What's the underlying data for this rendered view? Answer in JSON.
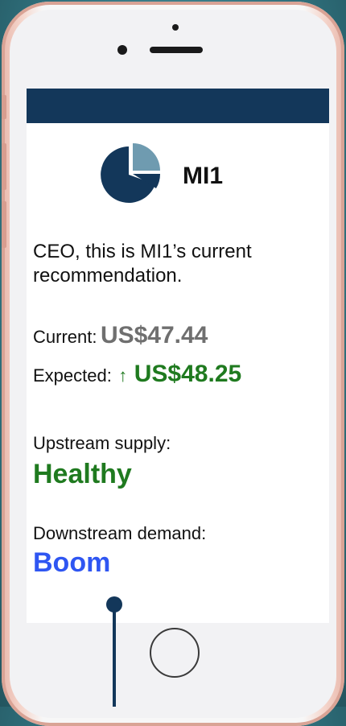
{
  "app": {
    "title": "MI1",
    "logo_icon": "pie-chart-icon"
  },
  "message": "CEO, this is MI1’s current recommendation.",
  "price": {
    "current_label": "Current:",
    "current_value": "US$47.44",
    "expected_label": "Expected:",
    "expected_arrow": "↑",
    "expected_value": "US$48.25"
  },
  "supply": {
    "label": "Upstream supply:",
    "value": "Healthy"
  },
  "demand": {
    "label": "Downstream demand:",
    "value": "Boom"
  },
  "colors": {
    "topbar": "#13375a",
    "positive": "#1f7a1f",
    "highlight": "#2f56f2",
    "neutral_value": "#6f6f6f",
    "background": "#2f6f7b"
  }
}
